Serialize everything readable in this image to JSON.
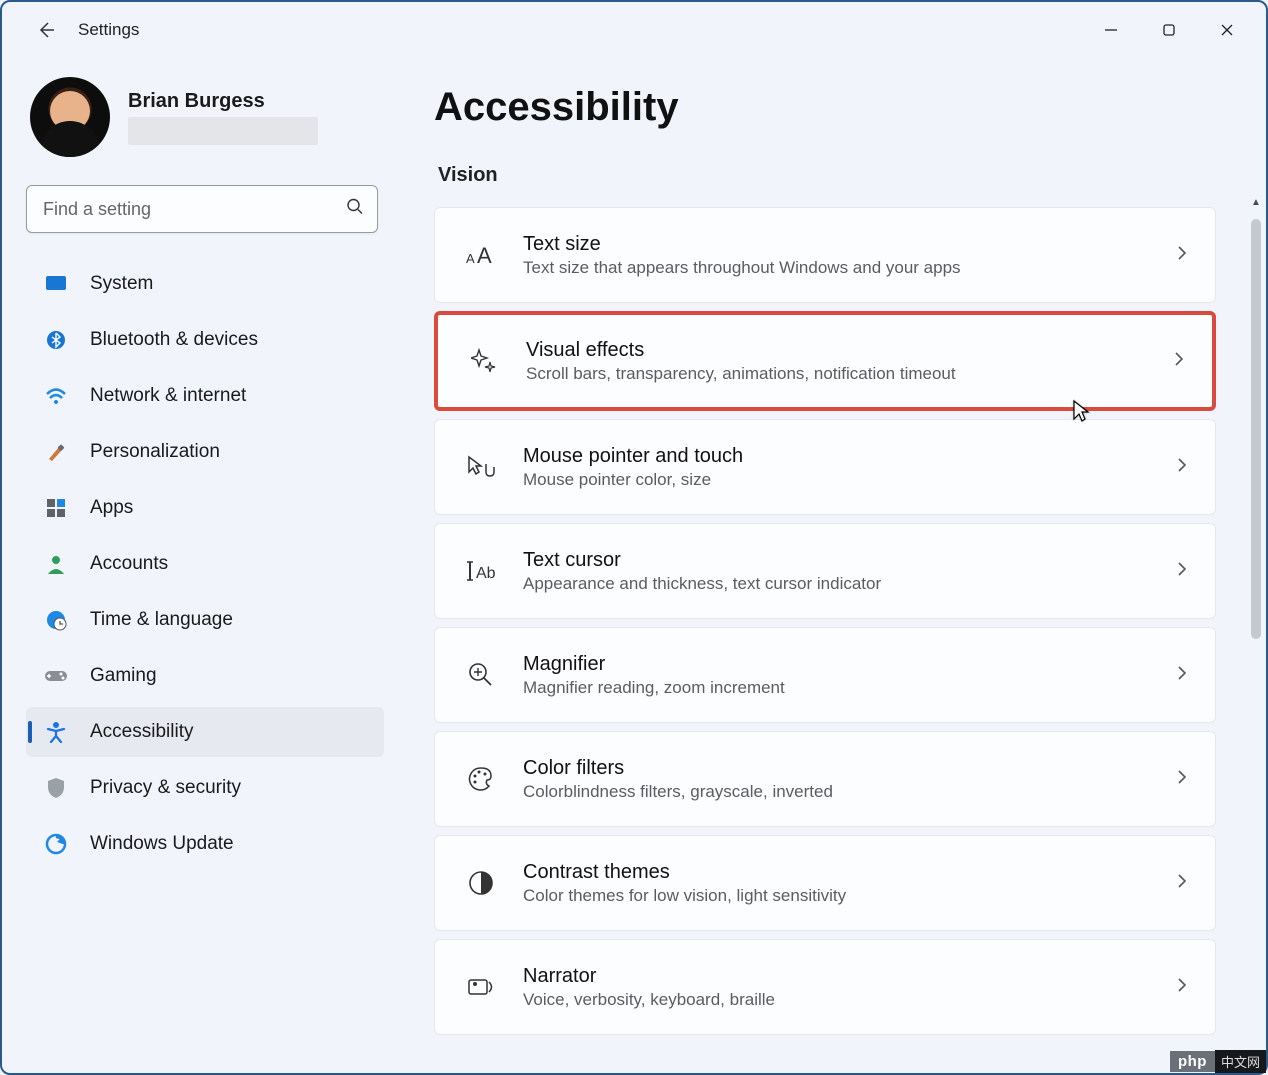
{
  "app": {
    "title": "Settings"
  },
  "user": {
    "name": "Brian Burgess"
  },
  "search": {
    "placeholder": "Find a setting"
  },
  "nav": {
    "items": [
      {
        "id": "system",
        "label": "System"
      },
      {
        "id": "bluetooth",
        "label": "Bluetooth & devices"
      },
      {
        "id": "network",
        "label": "Network & internet"
      },
      {
        "id": "personalization",
        "label": "Personalization"
      },
      {
        "id": "apps",
        "label": "Apps"
      },
      {
        "id": "accounts",
        "label": "Accounts"
      },
      {
        "id": "time",
        "label": "Time & language"
      },
      {
        "id": "gaming",
        "label": "Gaming"
      },
      {
        "id": "accessibility",
        "label": "Accessibility",
        "active": true
      },
      {
        "id": "privacy",
        "label": "Privacy & security"
      },
      {
        "id": "update",
        "label": "Windows Update"
      }
    ]
  },
  "page": {
    "title": "Accessibility",
    "section": "Vision",
    "cards": [
      {
        "id": "text-size",
        "title": "Text size",
        "sub": "Text size that appears throughout Windows and your apps"
      },
      {
        "id": "visual-effects",
        "title": "Visual effects",
        "sub": "Scroll bars, transparency, animations, notification timeout",
        "highlight": true
      },
      {
        "id": "mouse-pointer",
        "title": "Mouse pointer and touch",
        "sub": "Mouse pointer color, size"
      },
      {
        "id": "text-cursor",
        "title": "Text cursor",
        "sub": "Appearance and thickness, text cursor indicator"
      },
      {
        "id": "magnifier",
        "title": "Magnifier",
        "sub": "Magnifier reading, zoom increment"
      },
      {
        "id": "color-filters",
        "title": "Color filters",
        "sub": "Colorblindness filters, grayscale, inverted"
      },
      {
        "id": "contrast",
        "title": "Contrast themes",
        "sub": "Color themes for low vision, light sensitivity"
      },
      {
        "id": "narrator",
        "title": "Narrator",
        "sub": "Voice, verbosity, keyboard, braille"
      }
    ]
  },
  "watermark": {
    "left": "php",
    "right": "中文网"
  }
}
